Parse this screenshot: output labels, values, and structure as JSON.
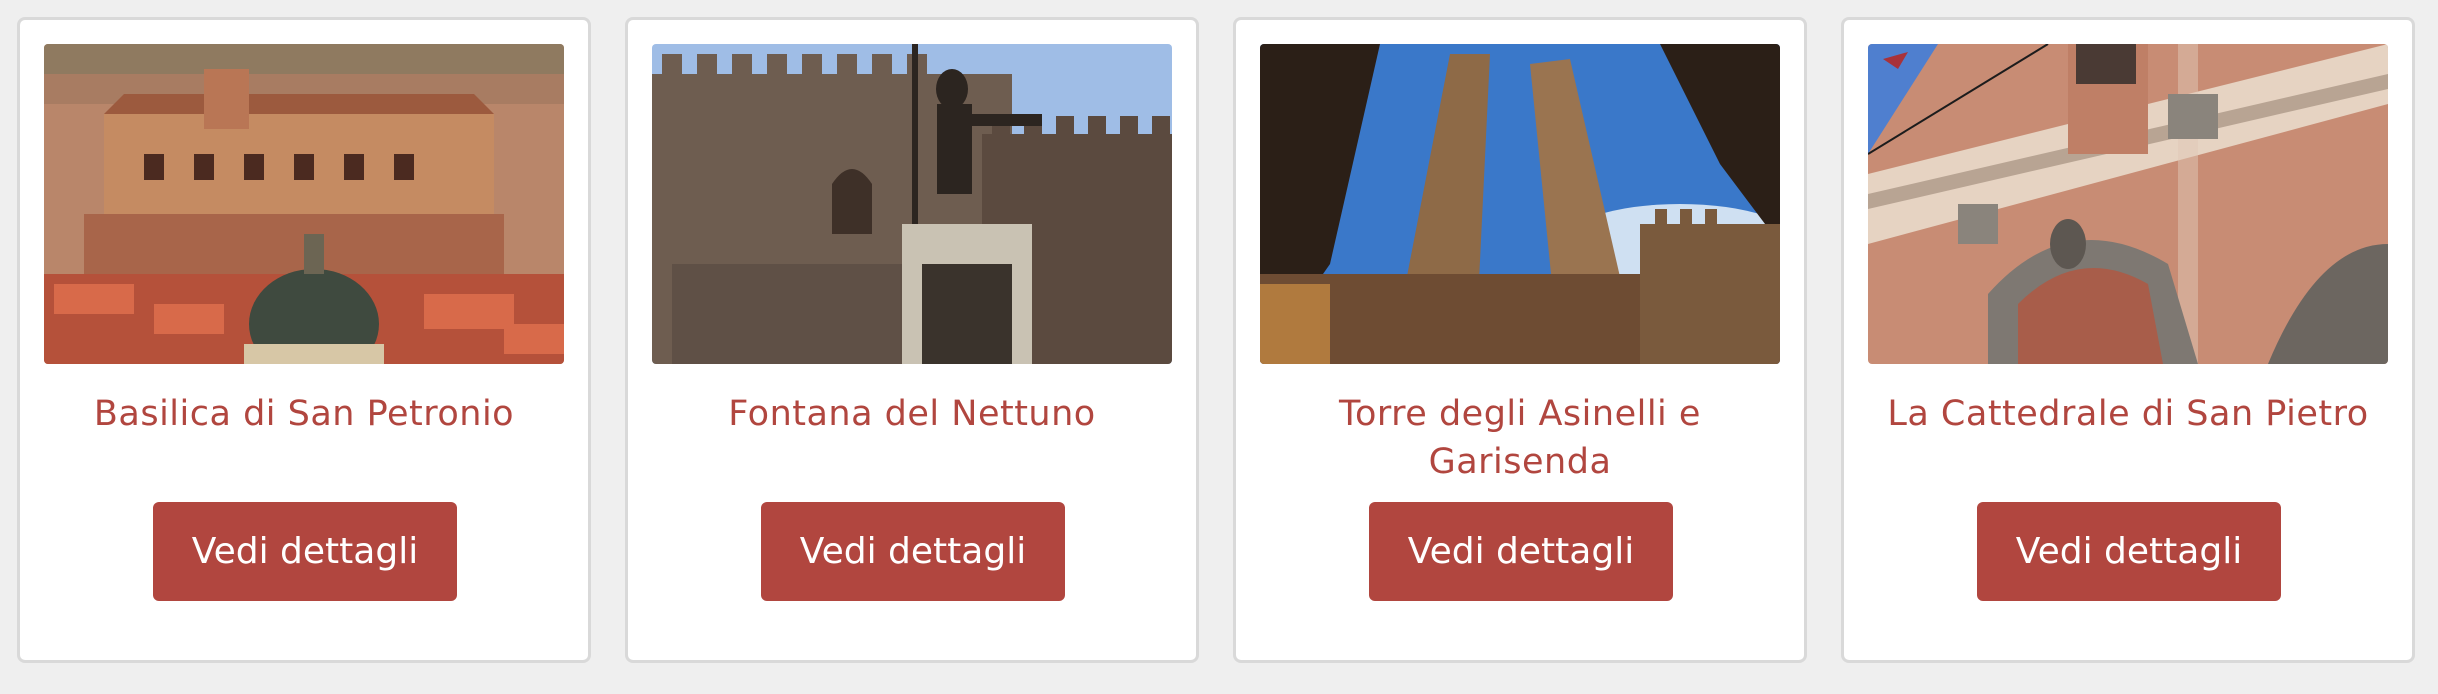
{
  "cards": [
    {
      "title": "Basilica di San Petronio",
      "button_label": "Vedi dettagli",
      "image_icon": "basilica-photo"
    },
    {
      "title": "Fontana del Nettuno",
      "button_label": "Vedi dettagli",
      "image_icon": "fountain-photo"
    },
    {
      "title": "Torre degli Asinelli e Garisenda",
      "button_label": "Vedi dettagli",
      "image_icon": "towers-photo"
    },
    {
      "title": "La Cattedrale di San Pietro",
      "button_label": "Vedi dettagli",
      "image_icon": "cathedral-photo"
    }
  ],
  "colors": {
    "accent": "#b1463f",
    "card_border": "#d9d9d9",
    "background": "#efefef"
  }
}
